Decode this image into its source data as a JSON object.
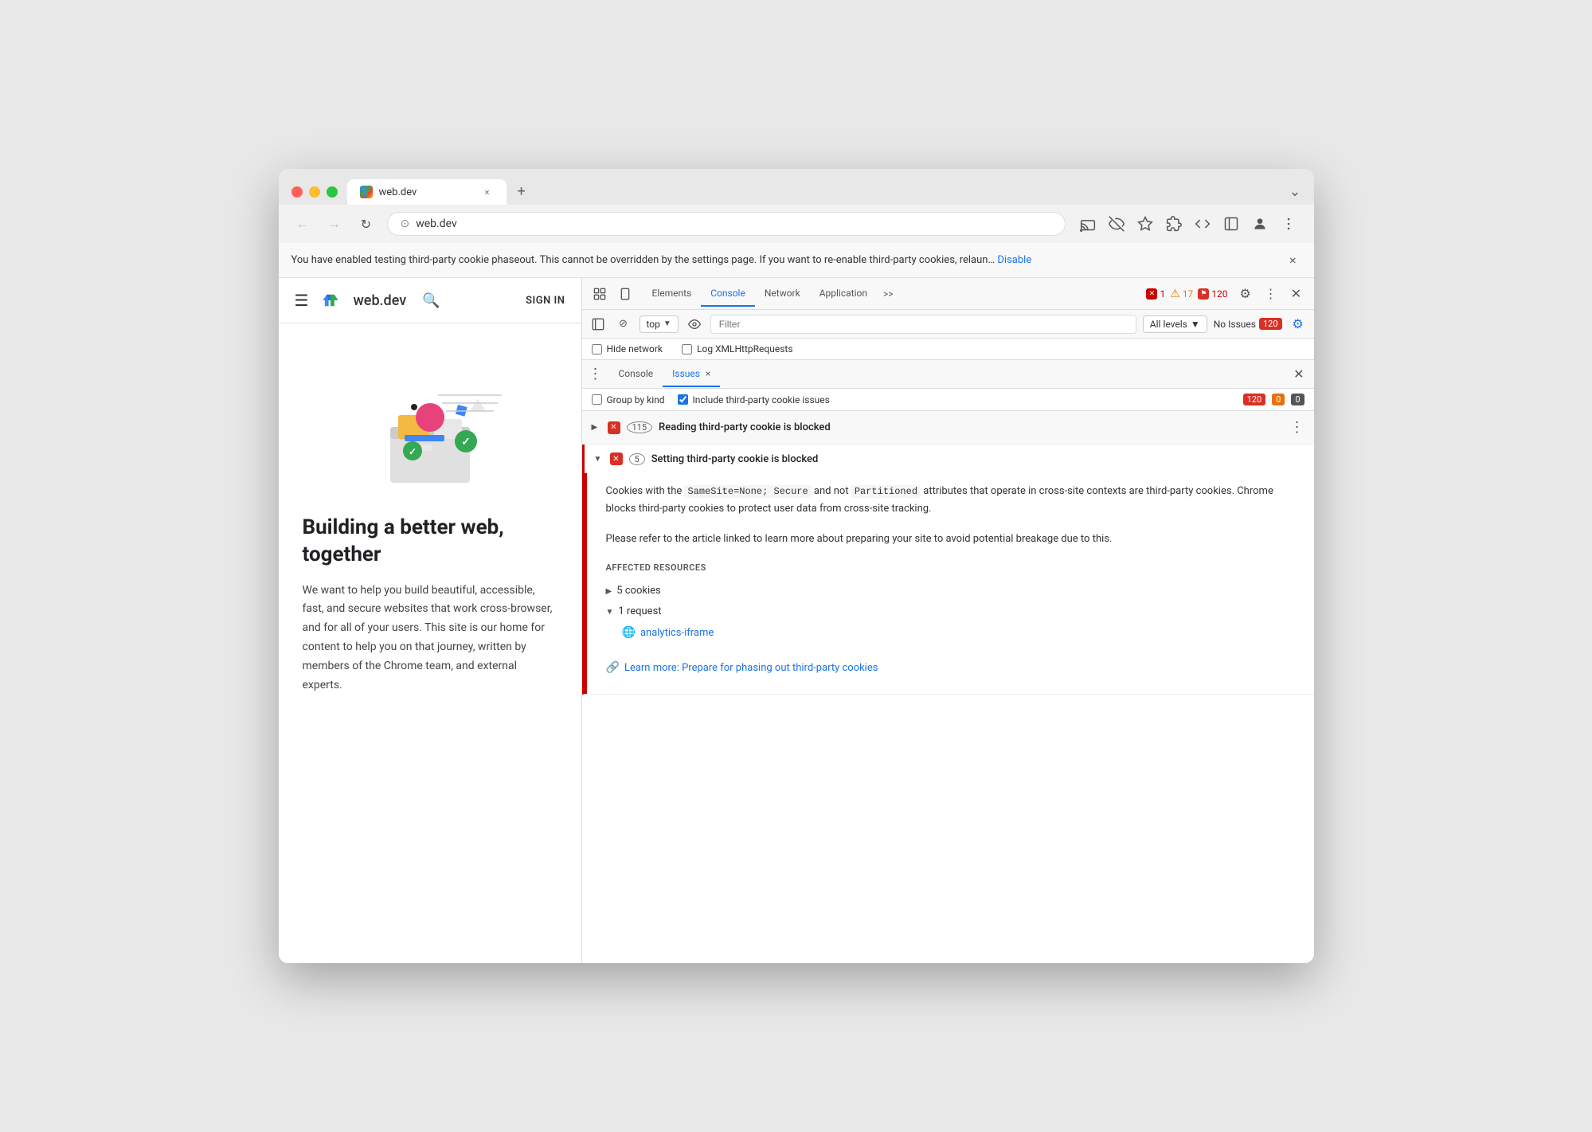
{
  "browser": {
    "tab": {
      "favicon": "w",
      "title": "web.dev",
      "close": "×"
    },
    "new_tab": "+",
    "expand_icon": "⌄",
    "address": "web.dev",
    "nav": {
      "back": "←",
      "forward": "→",
      "refresh": "↻",
      "address_icon": "⊙"
    },
    "toolbar_icons": [
      "⤓",
      "👁",
      "★",
      "□",
      "⚑",
      "□",
      "⋮"
    ],
    "info_bar": {
      "text": "You have enabled testing third-party cookie phaseout. This cannot be overridden by the settings page. If you want to re-enable third-party cookies, relaun…",
      "link": "Disable",
      "close": "×"
    }
  },
  "webpage": {
    "hamburger": "☰",
    "logo": "web.dev",
    "sign_in": "SIGN IN",
    "heading": "Building a better web, together",
    "body": "We want to help you build beautiful, accessible, fast, and secure websites that work cross-browser, and for all of your users. This site is our home for content to help you on that journey, written by members of the Chrome team, and external experts."
  },
  "devtools": {
    "tabs": [
      "Elements",
      "Console",
      "Network",
      "Application"
    ],
    "active_tab": "Console",
    "more_tabs": ">>",
    "badges": {
      "errors": "1",
      "warnings": "17",
      "issues": "120"
    },
    "console_toolbar": {
      "top_label": "top",
      "filter_placeholder": "Filter",
      "levels_label": "All levels",
      "no_issues_label": "No Issues",
      "no_issues_count": "120"
    },
    "checkboxes": {
      "hide_network": "Hide network",
      "log_xml": "Log XMLHttpRequests"
    },
    "panel_tabs": {
      "console": "Console",
      "issues": "Issues",
      "close": "×"
    },
    "issues": {
      "toolbar": {
        "group_by_kind": "Group by kind",
        "include_third_party": "Include third-party cookie issues",
        "count_red": "120",
        "count_warn": "0",
        "count_info": "0"
      },
      "items": [
        {
          "id": "reading-blocked",
          "expanded": false,
          "error_icon": "✕",
          "count": "115",
          "title": "Reading third-party cookie is blocked"
        },
        {
          "id": "setting-blocked",
          "expanded": true,
          "error_icon": "✕",
          "count": "5",
          "title": "Setting third-party cookie is blocked",
          "body": {
            "para1_before": "Cookies with the ",
            "code1": "SameSite=None; Secure",
            "para1_mid": " and not ",
            "code2": "Partitioned",
            "para1_after": " attributes that operate in cross-site contexts are third-party cookies. Chrome blocks third-party cookies to protect user data from cross-site tracking.",
            "para2": "Please refer to the article linked to learn more about preparing your site to avoid potential breakage due to this.",
            "affected_label": "AFFECTED RESOURCES",
            "resources": [
              {
                "type": "collapsed",
                "label": "5 cookies",
                "arrow": "▶"
              },
              {
                "type": "expanded",
                "label": "1 request",
                "arrow": "▼",
                "child": "analytics-iframe"
              }
            ],
            "learn_more_text": "Learn more: Prepare for phasing out third-party cookies",
            "learn_more_url": "#"
          }
        }
      ]
    }
  }
}
